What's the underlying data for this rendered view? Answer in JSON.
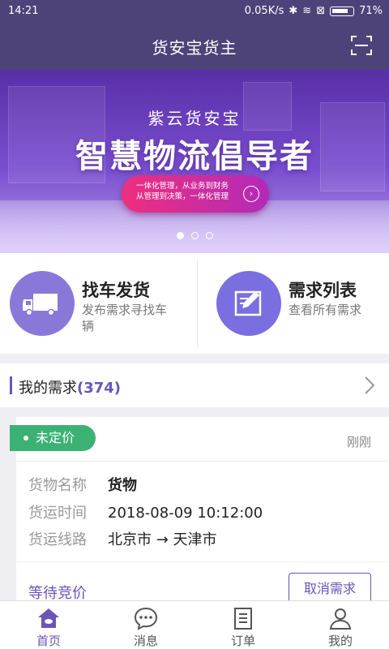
{
  "status_bar": {
    "time": "14:21",
    "network_speed": "0.05K/s",
    "battery": "71%"
  },
  "header": {
    "title": "货安宝货主",
    "scan_icon": "scan-icon"
  },
  "banner": {
    "brand": "紫云货安宝",
    "headline": "智慧物流倡导者",
    "pill_line1": "一体化管理，从业务到财务",
    "pill_line2": "从管理到决策，一体化管理",
    "slide_count": 3,
    "active_slide": 1
  },
  "quick_actions": [
    {
      "title": "找车发货",
      "desc": "发布需求寻找车辆",
      "icon": "truck-icon"
    },
    {
      "title": "需求列表",
      "desc": "查看所有需求",
      "icon": "edit-icon"
    }
  ],
  "my_demands": {
    "label": "我的需求",
    "count": "(374)"
  },
  "demand_card": {
    "tag": "未定价",
    "time": "刚刚",
    "rows": [
      {
        "key": "货物名称",
        "value": "货物"
      },
      {
        "key": "货运时间",
        "value": "2018-08-09 10:12:00"
      },
      {
        "key": "货运线路",
        "value": "北京市 → 天津市"
      }
    ],
    "status": "等待竞价",
    "cancel_label": "取消需求"
  },
  "tabs": [
    {
      "label": "首页",
      "icon": "home-icon",
      "active": true
    },
    {
      "label": "消息",
      "icon": "message-icon",
      "active": false
    },
    {
      "label": "订单",
      "icon": "order-icon",
      "active": false
    },
    {
      "label": "我的",
      "icon": "profile-icon",
      "active": false
    }
  ],
  "colors": {
    "primary": "#4e4379",
    "accent": "#6a54b8",
    "tag_green": "#3bb273"
  }
}
